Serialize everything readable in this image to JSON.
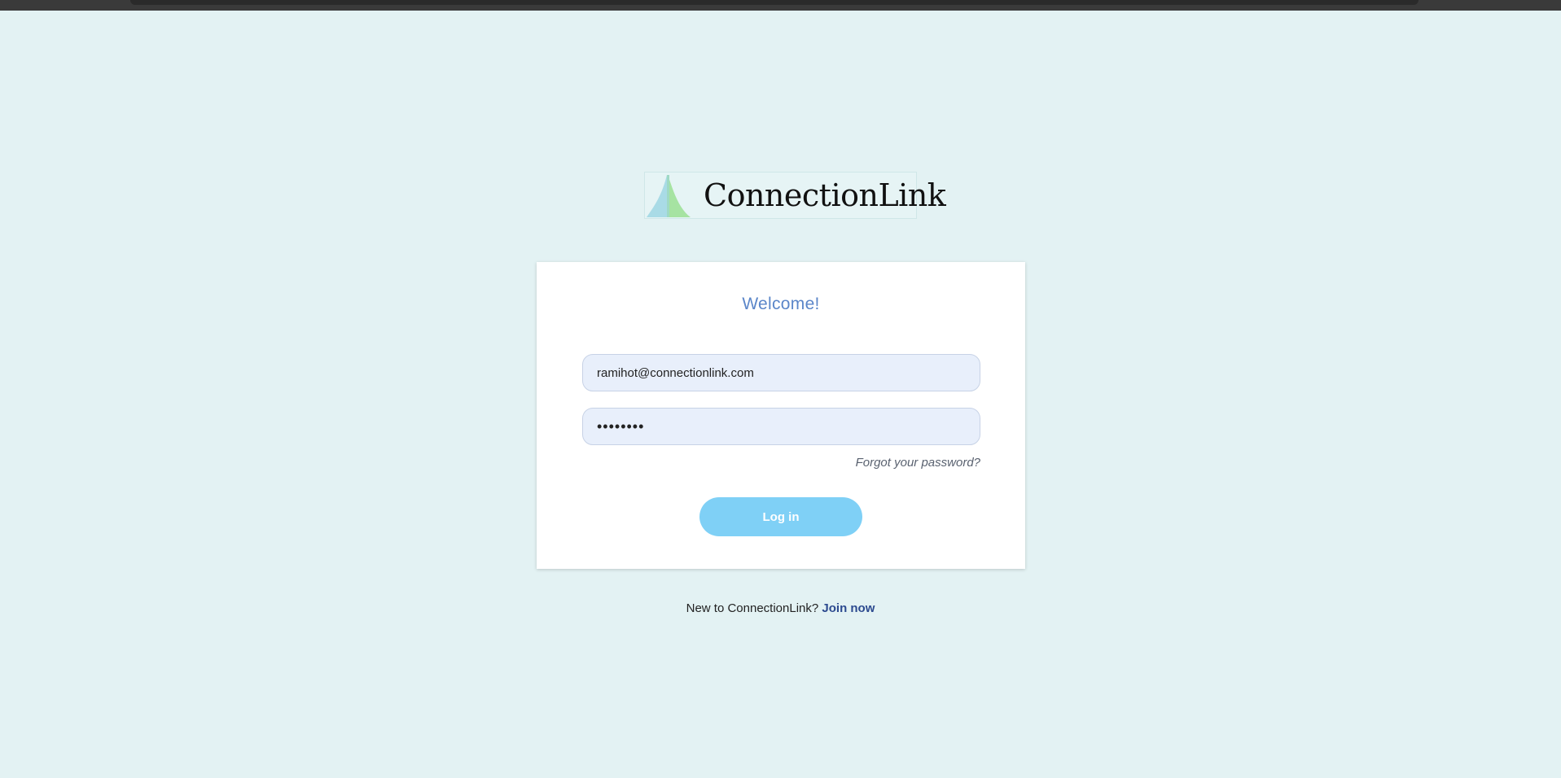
{
  "app": {
    "brand_name": "ConnectionLink"
  },
  "login": {
    "heading": "Welcome!",
    "email_value": "ramihot@connectionlink.com",
    "password_value": "••••••••",
    "forgot_label": "Forgot your password?",
    "submit_label": "Log in"
  },
  "signup": {
    "prompt": "New to ConnectionLink?",
    "link_label": "Join now"
  },
  "colors": {
    "background": "#e3f2f3",
    "heading": "#5b86c9",
    "button": "#7fd0f6",
    "link": "#2c4a8f"
  },
  "icons": {
    "logo": "connectionlink-logo-icon"
  }
}
